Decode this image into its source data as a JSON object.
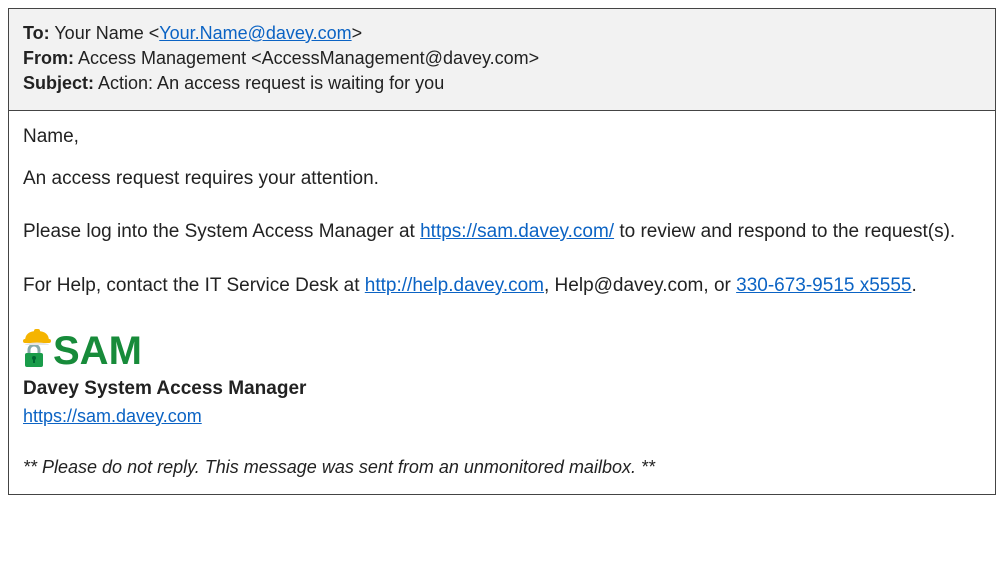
{
  "header": {
    "to_label": "To:",
    "to_name_prefix": " Your Name <",
    "to_email": "Your.Name@davey.com",
    "to_name_suffix": ">",
    "from_label": "From:",
    "from_value": " Access Management <AccessManagement@davey.com>",
    "subject_label": "Subject:",
    "subject_value": " Action: An access request is waiting for you"
  },
  "body": {
    "greeting": "Name,",
    "line1": "An access request requires your attention.",
    "line2_pre": "Please log into the System Access Manager at ",
    "sam_url": "https://sam.davey.com/",
    "line2_post": " to review and respond to the request(s).",
    "line3_pre": "For Help, contact the IT Service Desk at ",
    "help_url": "http://help.davey.com",
    "line3_mid1": ", Help@davey.com, or ",
    "phone": "330-673-9515 x5555",
    "line3_end": "."
  },
  "signature": {
    "logo_text": "SAM",
    "title": "Davey System Access Manager",
    "link": "https://sam.davey.com"
  },
  "footer": {
    "note": "** Please do not reply.  This message was sent from an unmonitored mailbox. **"
  }
}
